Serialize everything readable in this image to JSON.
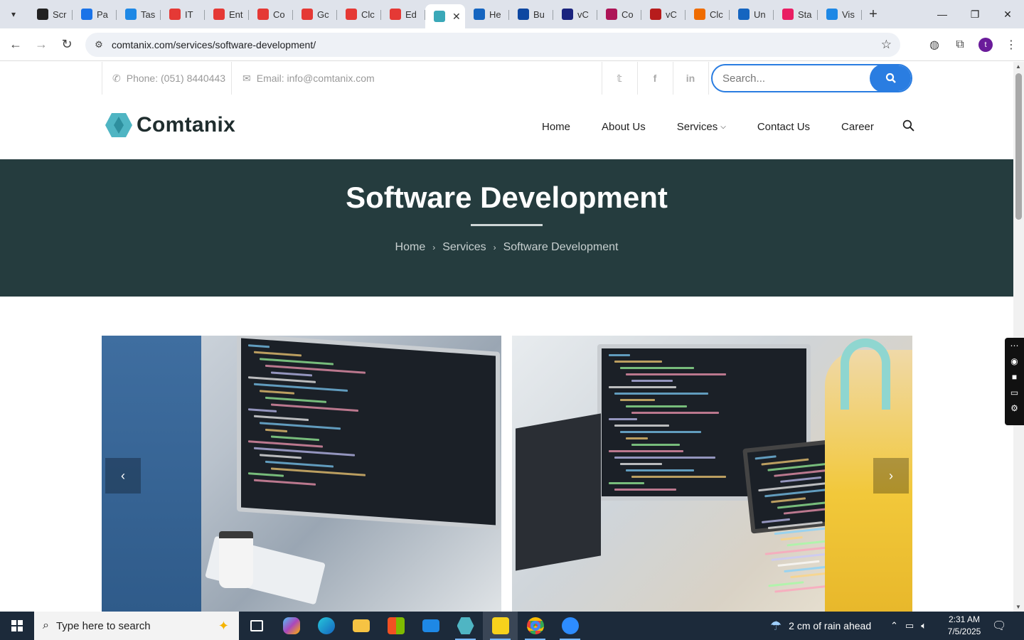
{
  "browser": {
    "tabs": [
      {
        "label": "Scr",
        "color": "#222222"
      },
      {
        "label": "Pa",
        "color": "#1a73e8"
      },
      {
        "label": "Tas",
        "color": "#1e88e5"
      },
      {
        "label": "IT",
        "color": "#e53935"
      },
      {
        "label": "Ent",
        "color": "#e53935"
      },
      {
        "label": "Co",
        "color": "#e53935"
      },
      {
        "label": "Gc",
        "color": "#e53935"
      },
      {
        "label": "Clc",
        "color": "#e53935"
      },
      {
        "label": "Ed",
        "color": "#e53935"
      },
      {
        "label": "",
        "color": "#3aa8b8",
        "active": true
      },
      {
        "label": "He",
        "color": "#1565c0"
      },
      {
        "label": "Bu",
        "color": "#0d47a1"
      },
      {
        "label": "vC",
        "color": "#1a237e"
      },
      {
        "label": "Co",
        "color": "#ad1457"
      },
      {
        "label": "vC",
        "color": "#b71c1c"
      },
      {
        "label": "Clc",
        "color": "#ef6c00"
      },
      {
        "label": "Un",
        "color": "#1565c0"
      },
      {
        "label": "Sta",
        "color": "#e91e63"
      },
      {
        "label": "Vis",
        "color": "#1e88e5"
      }
    ],
    "url": "comtanix.com/services/software-development/",
    "profile_initial": "t"
  },
  "topbar": {
    "phone": "Phone: (051) 8440443",
    "email": "Email: info@comtanix.com",
    "search_placeholder": "Search..."
  },
  "header": {
    "logo_text": "Comtanix",
    "nav": [
      {
        "label": "Home"
      },
      {
        "label": "About Us"
      },
      {
        "label": "Services"
      },
      {
        "label": "Contact Us"
      },
      {
        "label": "Career"
      }
    ]
  },
  "hero": {
    "title": "Software Development",
    "breadcrumb": [
      "Home",
      "Services",
      "Software Development"
    ]
  },
  "taskbar": {
    "search_text": "Type here to search",
    "weather": "2 cm of rain ahead",
    "time": "2:31 AM",
    "date": "7/5/2025"
  }
}
